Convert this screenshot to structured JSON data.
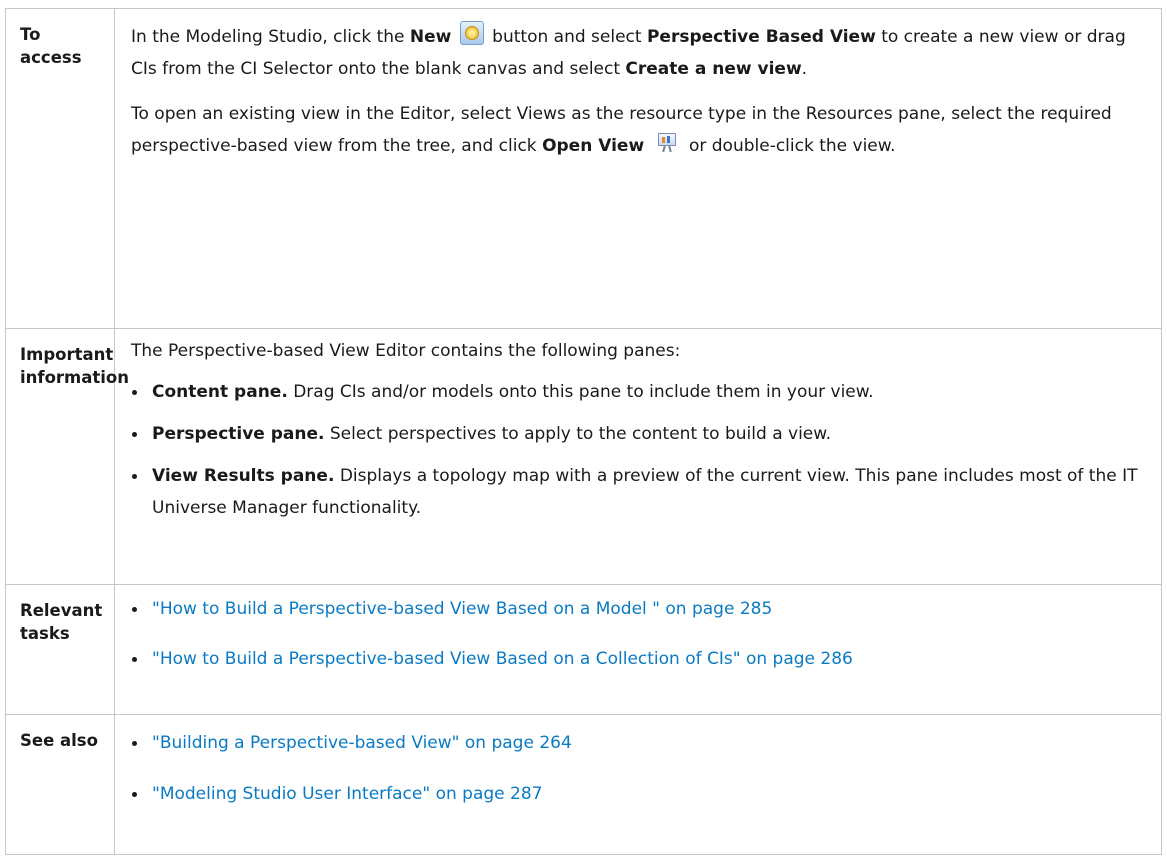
{
  "rows": {
    "access": {
      "label": "To access",
      "p1_prefix": "In the Modeling Studio, click the",
      "new_label": "New",
      "p1_mid1": "button and select",
      "perspective_view_label": "Perspective Based View",
      "p1_mid2": "to create a new view or drag CIs from the CI Selector onto the blank canvas and select",
      "create_view_label": "Create a new view",
      "p1_end": ".",
      "p2_text": "To open an existing view in the Editor, select Views as the resource type in the Resources pane, select the required perspective-based view from the tree, and click",
      "open_view_label": "Open View",
      "p2_end": "or double-click the view.",
      "icons": {
        "new": "new-star-icon",
        "open_view": "open-view-presentation-icon"
      }
    },
    "important": {
      "label": "Important information",
      "intro": "The Perspective-based View Editor contains the following panes:",
      "items": [
        {
          "term": "Content pane.",
          "desc": "Drag CIs and/or models onto this pane to include them in your view."
        },
        {
          "term": "Perspective pane.",
          "desc": "Select perspectives to apply to the content to build a view."
        },
        {
          "term": "View Results pane.",
          "desc": "Displays a topology map with a preview of the current view. This pane includes most of the IT Universe Manager functionality."
        }
      ]
    },
    "tasks": {
      "label": "Relevant tasks",
      "links": [
        "\"How to Build a Perspective-based View Based on a Model \" on page 285",
        "\"How to Build a Perspective-based View Based on a Collection of CIs\" on page 286"
      ]
    },
    "see_also": {
      "label": "See also",
      "links": [
        "\"Building a Perspective-based View\" on page 264",
        "\"Modeling Studio User Interface\" on page 287"
      ]
    }
  },
  "colors": {
    "link": "#0a7ac4",
    "border": "#c6c6c6",
    "text": "#1a1a1a"
  }
}
